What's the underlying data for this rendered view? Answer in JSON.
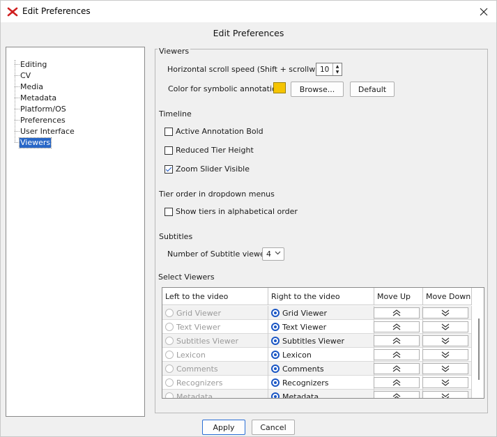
{
  "window": {
    "title": "Edit Preferences",
    "header": "Edit Preferences"
  },
  "sidebar": {
    "items": [
      {
        "label": "Editing",
        "selected": false
      },
      {
        "label": "CV",
        "selected": false
      },
      {
        "label": "Media",
        "selected": false
      },
      {
        "label": "Metadata",
        "selected": false
      },
      {
        "label": "Platform/OS",
        "selected": false
      },
      {
        "label": "Preferences",
        "selected": false
      },
      {
        "label": "User Interface",
        "selected": false
      },
      {
        "label": "Viewers",
        "selected": true
      }
    ]
  },
  "viewers": {
    "legend": "Viewers",
    "scroll_label": "Horizontal scroll speed (Shift + scrollwheel)",
    "scroll_value": "10",
    "color_label": "Color for symbolic annotations",
    "color_value": "#f5c400",
    "browse_label": "Browse...",
    "default_label": "Default"
  },
  "timeline": {
    "heading": "Timeline",
    "options": [
      {
        "label": "Active Annotation Bold",
        "checked": false
      },
      {
        "label": "Reduced Tier Height",
        "checked": false
      },
      {
        "label": "Zoom Slider Visible",
        "checked": true
      }
    ]
  },
  "tier_order": {
    "heading": "Tier order in dropdown menus",
    "option_label": "Show tiers in alphabetical order",
    "checked": false
  },
  "subtitles": {
    "heading": "Subtitles",
    "count_label": "Number of Subtitle viewers",
    "count_value": "4"
  },
  "select_viewers": {
    "heading": "Select Viewers",
    "columns": [
      "Left to the  video",
      "Right to the video",
      "Move Up",
      "Move Down"
    ],
    "rows": [
      {
        "left": "Grid Viewer",
        "right": "Grid Viewer",
        "side": "right"
      },
      {
        "left": "Text Viewer",
        "right": "Text Viewer",
        "side": "right"
      },
      {
        "left": "Subtitles Viewer",
        "right": "Subtitles Viewer",
        "side": "right"
      },
      {
        "left": "Lexicon",
        "right": "Lexicon",
        "side": "right"
      },
      {
        "left": "Comments",
        "right": "Comments",
        "side": "right"
      },
      {
        "left": "Recognizers",
        "right": "Recognizers",
        "side": "right"
      },
      {
        "left": "Metadata",
        "right": "Metadata",
        "side": "right"
      }
    ]
  },
  "footer": {
    "apply_label": "Apply",
    "cancel_label": "Cancel"
  }
}
